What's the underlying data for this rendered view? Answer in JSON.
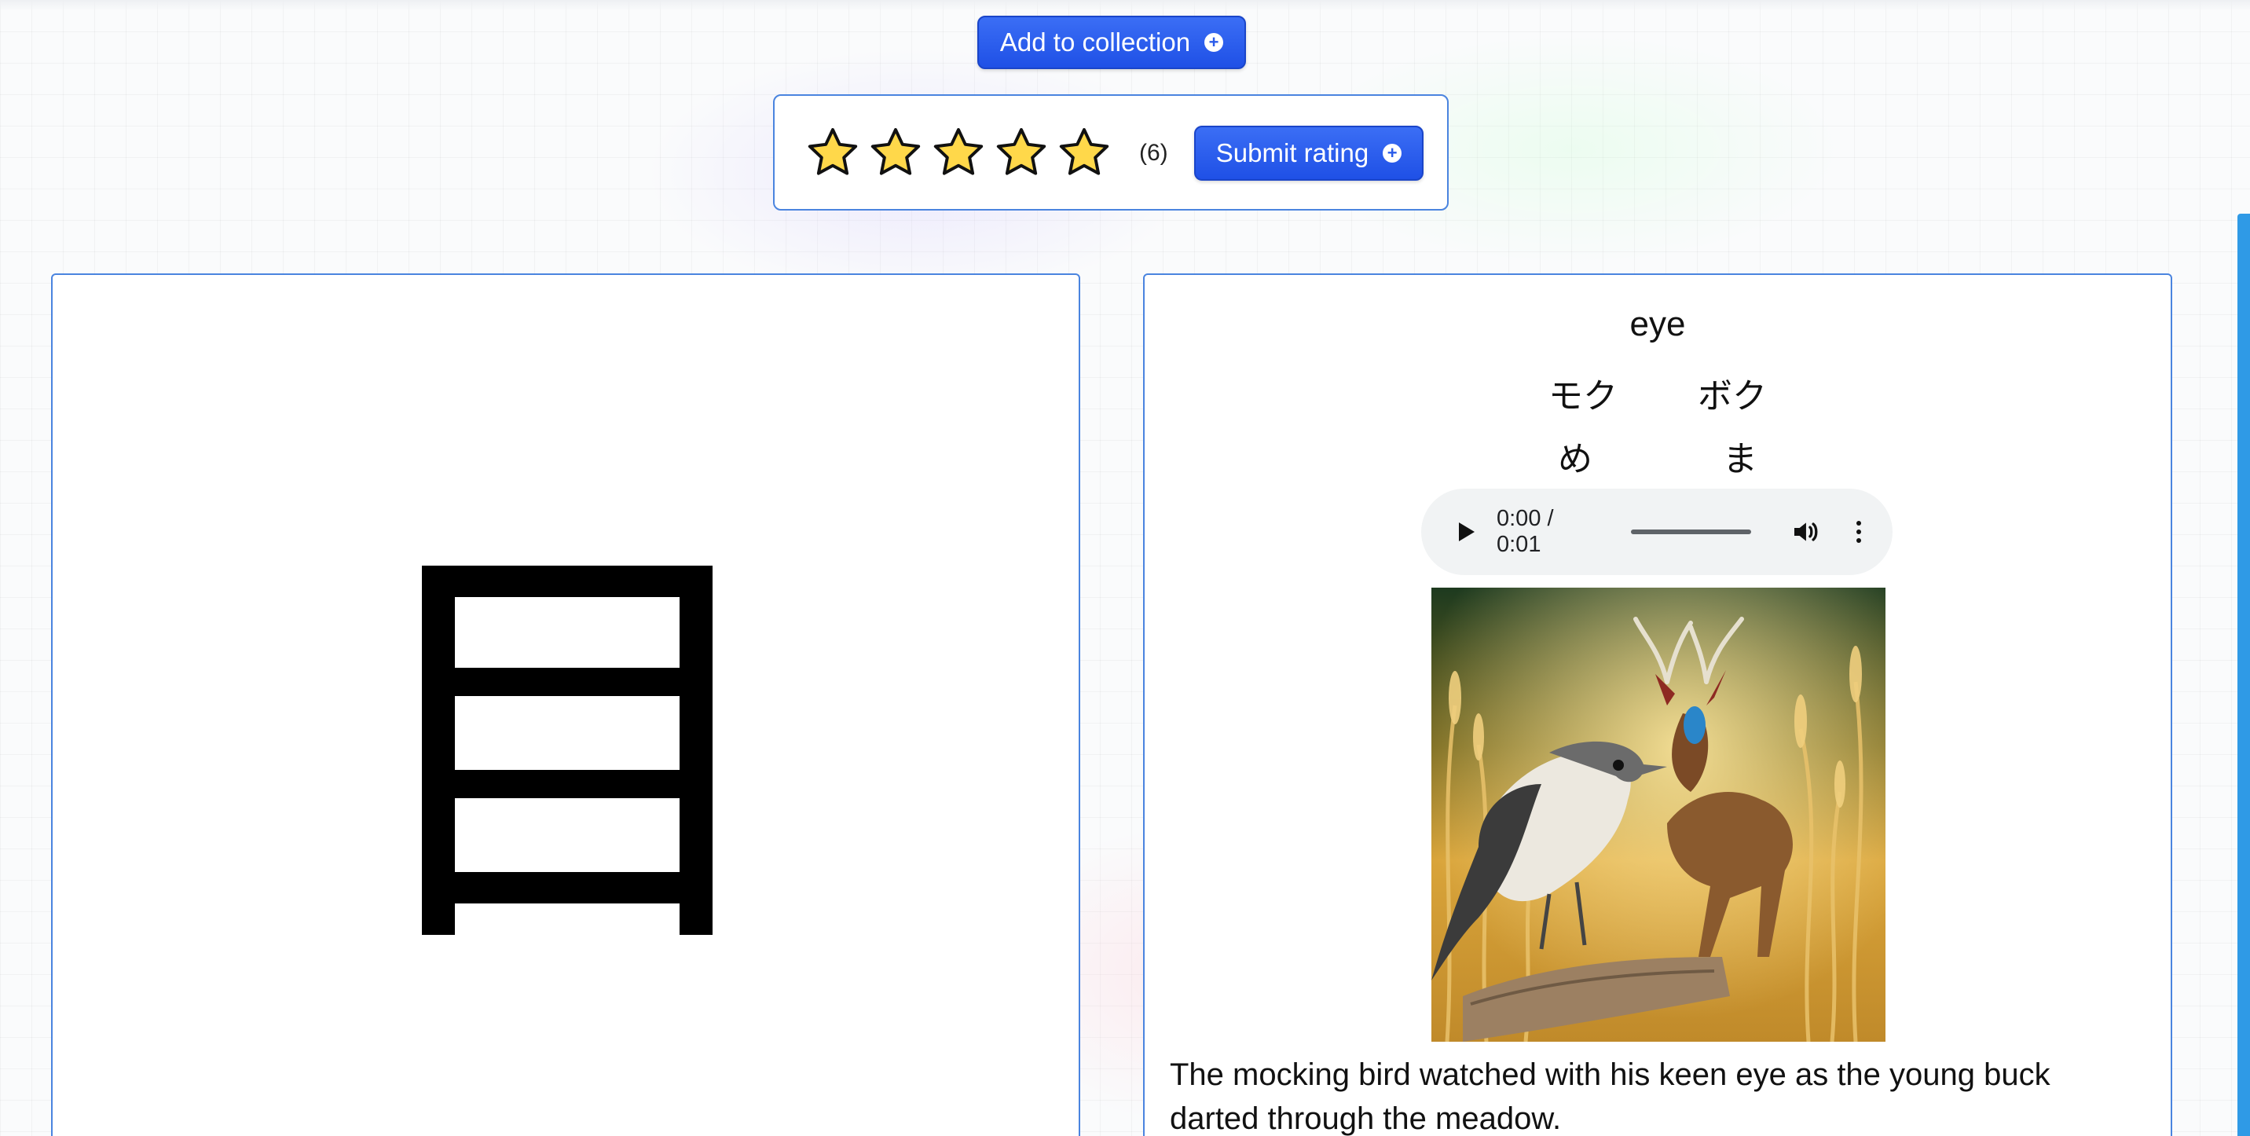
{
  "actions": {
    "add_to_collection": "Add to collection",
    "submit_rating": "Submit rating"
  },
  "rating": {
    "stars_total": 5,
    "count_label": "(6)",
    "star_color": "#ffd84a"
  },
  "kanji": {
    "character": "目",
    "meaning": "eye",
    "on_readings": [
      "モク",
      "ボク"
    ],
    "kun_readings": [
      "め",
      "ま"
    ]
  },
  "audio": {
    "time": "0:00 / 0:01"
  },
  "mnemonic": {
    "sentence": "The mocking bird watched with his keen eye as the young buck darted through the meadow."
  },
  "colors": {
    "accent": "#2a5be9",
    "card_border": "#4a84df",
    "scrollbar": "#2f9ae6"
  }
}
